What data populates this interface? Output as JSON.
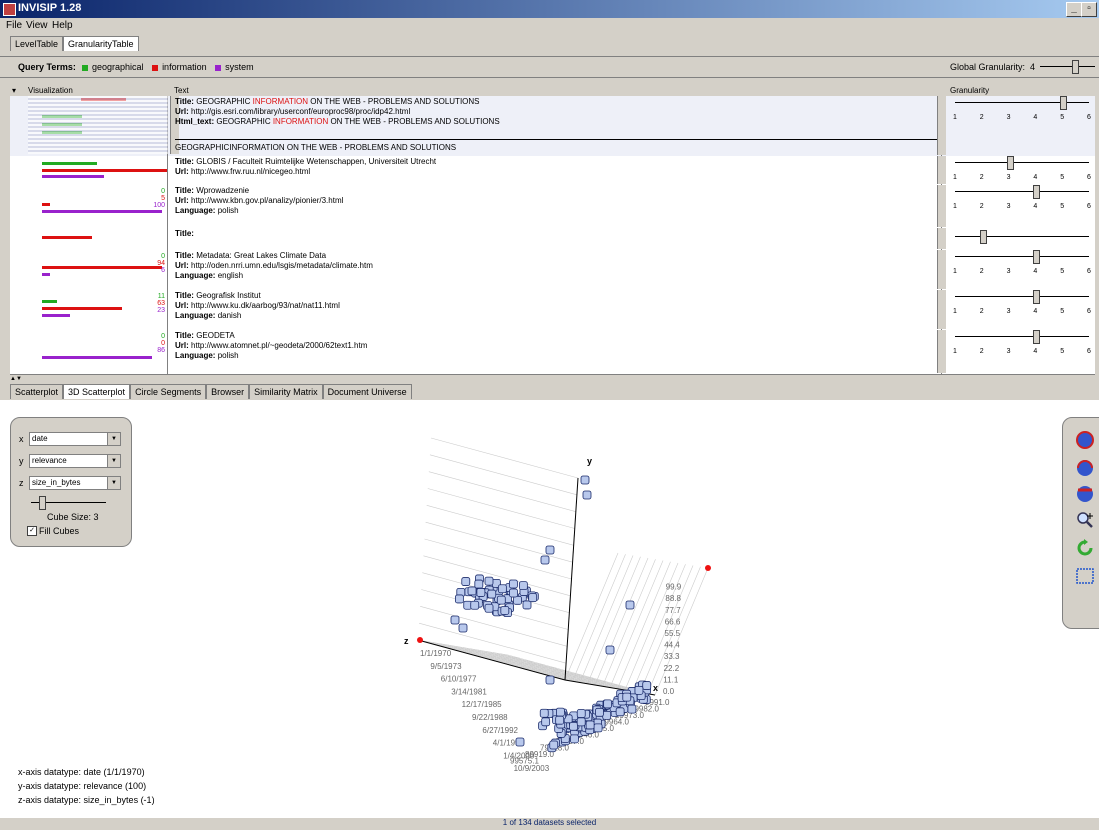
{
  "window": {
    "title": "INVISIP 1.28"
  },
  "menu": [
    "File",
    "View",
    "Help"
  ],
  "top_tabs": [
    "LevelTable",
    "GranularityTable"
  ],
  "query": {
    "label": "Query Terms:",
    "terms": [
      {
        "label": "geographical",
        "color": "#22aa22"
      },
      {
        "label": "information",
        "color": "#dd1111"
      },
      {
        "label": "system",
        "color": "#9922cc"
      }
    ],
    "global_label": "Global Granularity:",
    "global_value": "4"
  },
  "table": {
    "headers": [
      "Visualization",
      "Text",
      "Granularity"
    ],
    "ticks": [
      "1",
      "2",
      "3",
      "4",
      "5",
      "6"
    ],
    "rows": [
      {
        "title": "GEOGRAPHIC INFORMATION ON THE WEB - PROBLEMS AND SOLUTIONS",
        "title_pre": "GEOGRAPHIC ",
        "title_hl": "INFORMATION",
        "title_post": " ON THE WEB - PROBLEMS AND SOLUTIONS",
        "url": "http://gis.esri.com/library/userconf/europroc98/proc/idp42.html",
        "html_pre": "GEOGRAPHIC ",
        "html_hl": "INFORMATION",
        "html_post": " ON THE WEB - PROBLEMS AND SOLUTIONS",
        "body": "GEOGRAPHICINFORMATION ON THE WEB - PROBLEMS AND SOLUTIONS",
        "granularity": 5
      },
      {
        "title": "GLOBIS / Faculteit Ruimtelijke Wetenschappen, Universiteit Utrecht",
        "url": "http://www.frw.ruu.nl/nicegeo.html",
        "granularity": 3
      },
      {
        "title": "Wprowadzenie",
        "url": "http://www.kbn.gov.pl/analizy/pionier/3.html",
        "language": "polish",
        "counts": [
          "0",
          "5",
          "100"
        ],
        "granularity": 4
      },
      {
        "title": "",
        "granularity": 2
      },
      {
        "title": " Metadata: Great Lakes Climate Data",
        "url": "http://oden.nrri.umn.edu/lsgis/metadata/climate.htm",
        "language": "english",
        "counts": [
          "0",
          "94",
          "6"
        ],
        "granularity": 4
      },
      {
        "title": "Geografisk Institut",
        "url": "http://www.ku.dk/aarbog/93/nat/nat11.html",
        "language": "danish",
        "counts": [
          "11",
          "63",
          "23"
        ],
        "granularity": 4
      },
      {
        "title": "GEODETA",
        "url": "http://www.atomnet.pl/~geodeta/2000/62text1.htm",
        "language": "polish",
        "counts": [
          "0",
          "0",
          "86"
        ],
        "granularity": 4
      }
    ],
    "field_labels": {
      "title": "Title:",
      "url": "Url:",
      "html": "Html_text:",
      "language": "Language:"
    }
  },
  "view_tabs": [
    "Scatterplot",
    "3D Scatterplot",
    "Circle Segments",
    "Browser",
    "Similarity Matrix",
    "Document Universe"
  ],
  "controls": {
    "x": "date",
    "y": "relevance",
    "z": "size_in_bytes",
    "x_label": "x",
    "y_label": "y",
    "z_label": "z",
    "cube_size": "Cube Size: 3",
    "fill_cubes": "Fill Cubes"
  },
  "tools": [
    "rotate-x-icon",
    "rotate-y-icon",
    "rotate-z-icon",
    "zoom-icon",
    "refresh-icon",
    "select-rect-icon"
  ],
  "axis_info": [
    "x-axis datatype: date (1/1/1970)",
    "y-axis datatype: relevance (100)",
    "z-axis datatype: size_in_bytes (-1)"
  ],
  "chart_data": {
    "type": "scatter",
    "axes": {
      "x": "x",
      "y": "y",
      "z": "z"
    },
    "x_ticks": [
      "1/1/1970",
      "9/5/1973",
      "6/10/1977",
      "3/14/1981",
      "12/17/1985",
      "9/22/1988",
      "6/27/1992",
      "4/1/1996",
      "1/4/2000",
      "10/9/2003"
    ],
    "y_ticks": [
      "0.0",
      "11.1",
      "22.2",
      "33.3",
      "44.4",
      "55.5",
      "66.6",
      "77.7",
      "88.8",
      "99.9"
    ],
    "z_ticks": [
      "9991.0",
      "19982.0",
      "29973.0",
      "39964.0",
      "49955.0",
      "59946.0",
      "69937.0",
      "79928.0",
      "89919.0",
      "99575.1"
    ]
  },
  "status": "1 of 134 datasets selected"
}
